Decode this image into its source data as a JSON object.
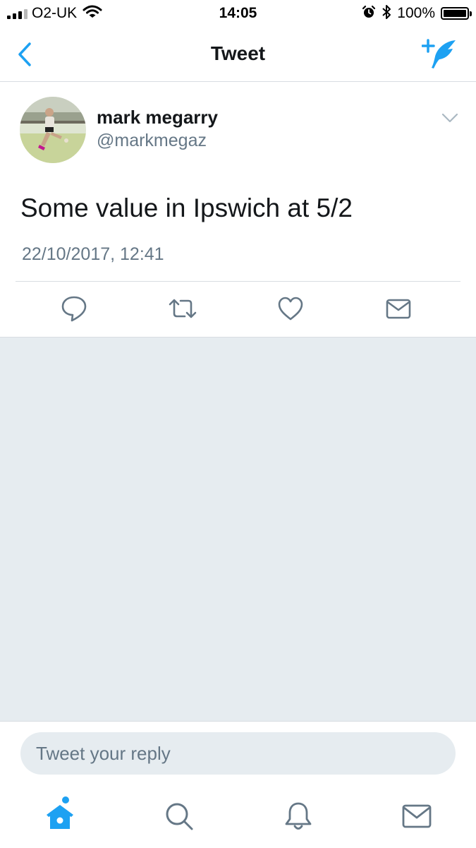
{
  "status_bar": {
    "carrier": "O2-UK",
    "time": "14:05",
    "battery_percent": "100%",
    "battery_level": 1.0,
    "icons": [
      "signal-icon",
      "wifi-icon",
      "alarm-icon",
      "bluetooth-icon",
      "battery-icon"
    ]
  },
  "nav": {
    "title": "Tweet",
    "back_icon": "chevron-left-icon",
    "compose_icon": "compose-feather-icon"
  },
  "tweet": {
    "author_name": "mark megarry",
    "author_handle": "@markmegaz",
    "text": "Some value in Ipswich at 5/2",
    "timestamp": "22/10/2017, 12:41",
    "actions": [
      "reply-icon",
      "retweet-icon",
      "like-icon",
      "direct-message-icon"
    ]
  },
  "reply": {
    "placeholder": "Tweet your reply"
  },
  "tab_bar": {
    "tabs": [
      "home-icon",
      "search-icon",
      "notifications-icon",
      "messages-icon"
    ],
    "home_has_badge": true
  },
  "colors": {
    "accent": "#1da1f2",
    "text": "#14171a",
    "secondary": "#657786",
    "background": "#e6ecf0",
    "divider": "#d8dde2"
  }
}
